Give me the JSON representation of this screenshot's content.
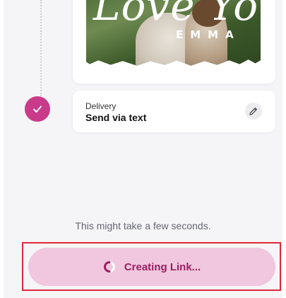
{
  "photo_card": {
    "script_text": "Love Yo",
    "name_text": "EMMA"
  },
  "delivery": {
    "label": "Delivery",
    "value": "Send via text",
    "edit_icon": "pencil-icon",
    "status_icon": "checkmark-icon"
  },
  "hint": "This might take a few seconds.",
  "create_button": {
    "label": "Creating Link...",
    "icon": "spinner-icon"
  },
  "colors": {
    "accent": "#c93a8a",
    "button_bg": "#f0c7de",
    "button_text": "#9b1f63",
    "highlight_border": "#e0283a"
  }
}
